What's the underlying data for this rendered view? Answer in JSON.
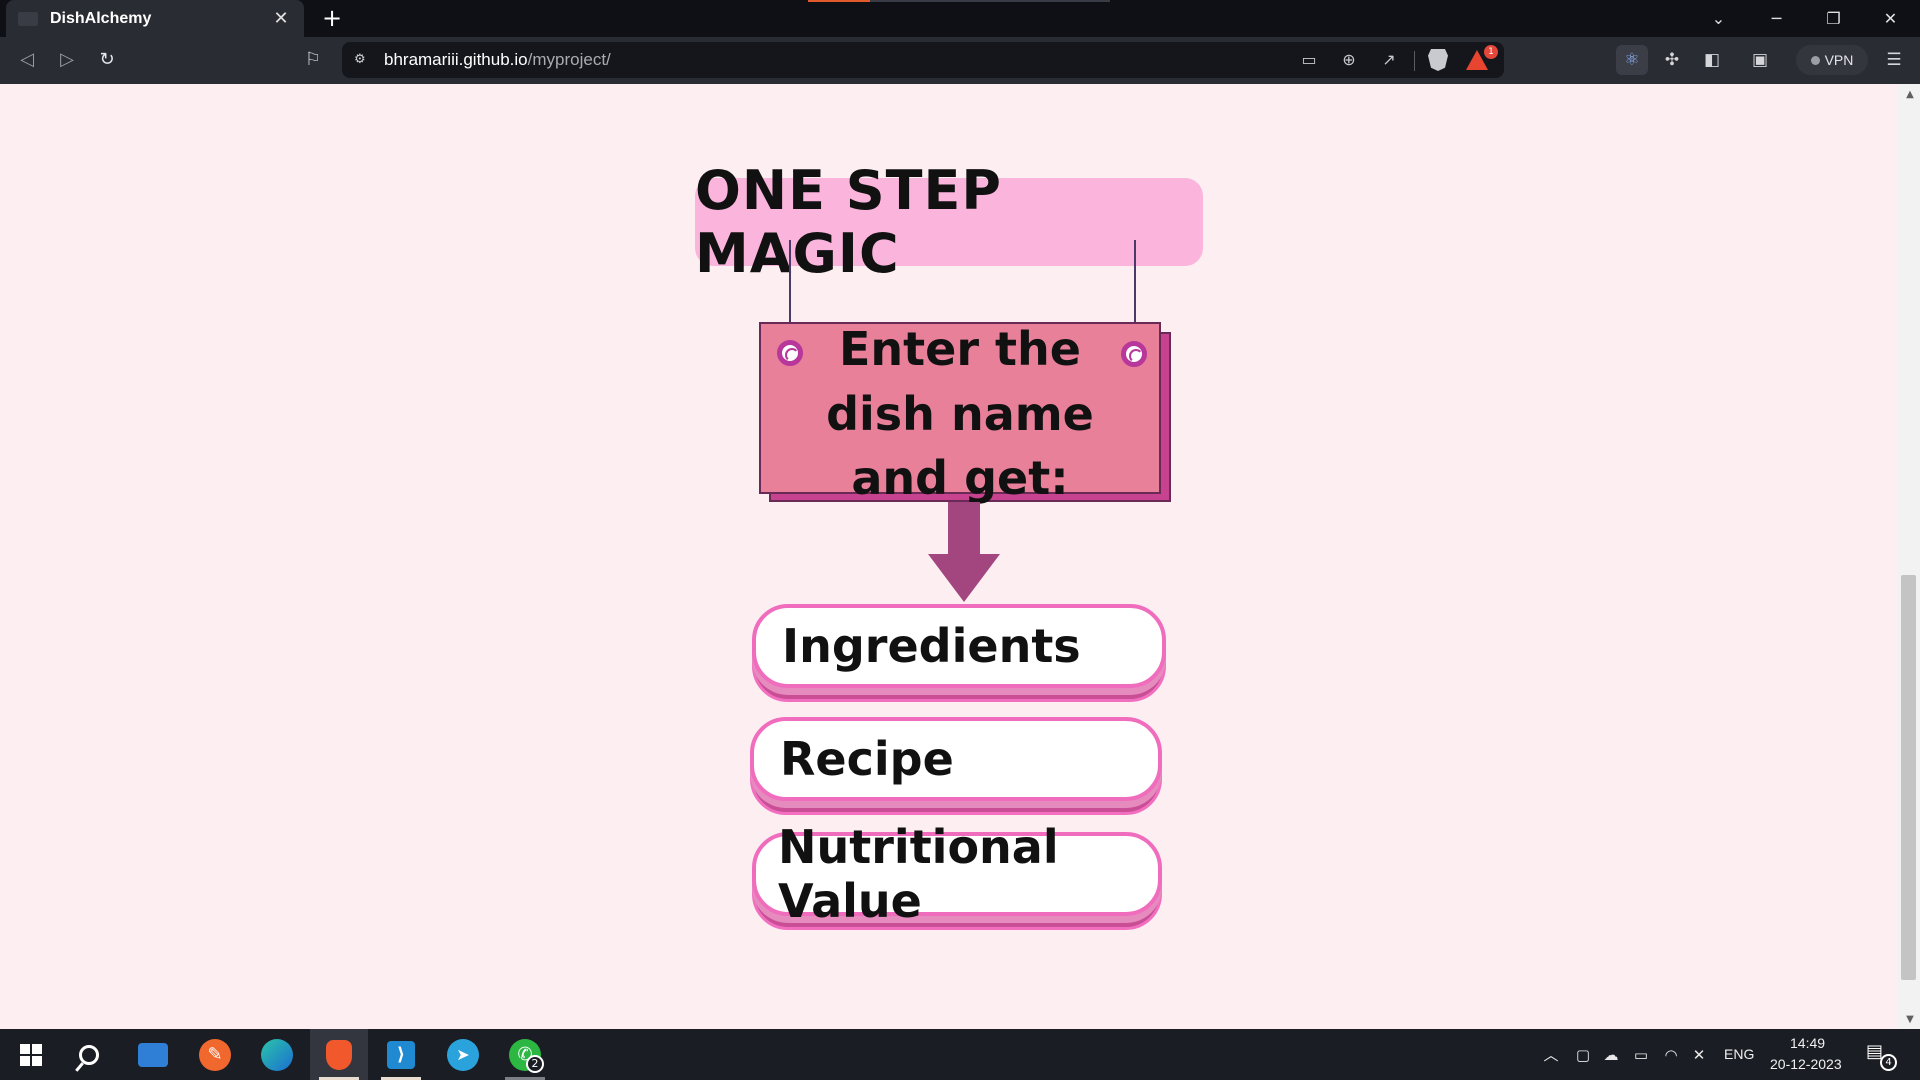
{
  "browser": {
    "tab_title": "DishAlchemy",
    "tab_close": "✕",
    "new_tab": "+",
    "url_host": "bhramariii.github.io",
    "url_path": "/myproject/",
    "rewards_count": "1",
    "vpn_label": "VPN",
    "window_controls": {
      "dropdown": "⌄",
      "minimize": "─",
      "restore": "❐",
      "close": "✕"
    }
  },
  "content": {
    "title": "ONE STEP MAGIC",
    "card_text": "Enter the dish name and get:",
    "options": [
      {
        "label": "Ingredients"
      },
      {
        "label": "Recipe"
      },
      {
        "label": "Nutritional Value"
      }
    ],
    "colors": {
      "title_bg": "#fbb4db",
      "card_bg": "#e8809a",
      "arrow": "#a34680",
      "pill_border": "#f06cbd",
      "page_bg": "#fdeef2"
    }
  },
  "taskbar": {
    "apps": [
      "windows-start",
      "search",
      "file-explorer",
      "postman",
      "edge",
      "brave",
      "vscode",
      "telegram",
      "whatsapp"
    ],
    "whatsapp_badge": "2",
    "language": "ENG",
    "time": "14:49",
    "date": "20-12-2023",
    "notification_count": "4"
  }
}
